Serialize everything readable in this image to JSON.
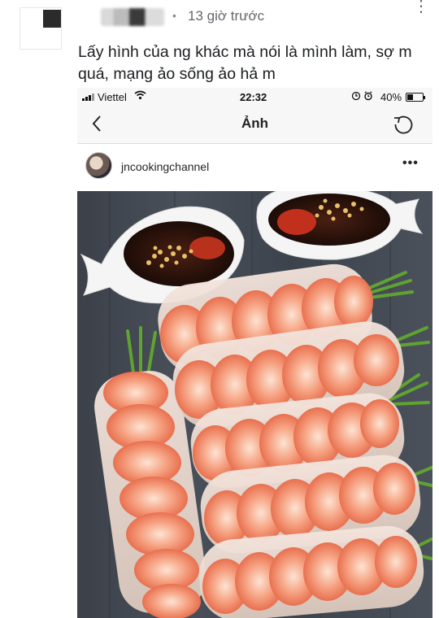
{
  "post": {
    "timestamp": "13 giờ trước",
    "separator": "•",
    "caption": "Lấy hình của ng khác mà nói là mình làm, sợ m quá, mạng ảo sống ảo hả m",
    "more_icon": "more-vertical-icon"
  },
  "screenshot": {
    "status_bar": {
      "carrier": "Viettel",
      "time": "22:32",
      "battery_percent": "40%",
      "battery_level": 0.4
    },
    "nav": {
      "title": "Ảnh",
      "back_icon": "chevron-left-icon",
      "refresh_icon": "refresh-icon"
    },
    "account": {
      "username": "jncookingchannel",
      "more_label": "•••"
    },
    "photo": {
      "subject": "spring-rolls-photo"
    }
  }
}
